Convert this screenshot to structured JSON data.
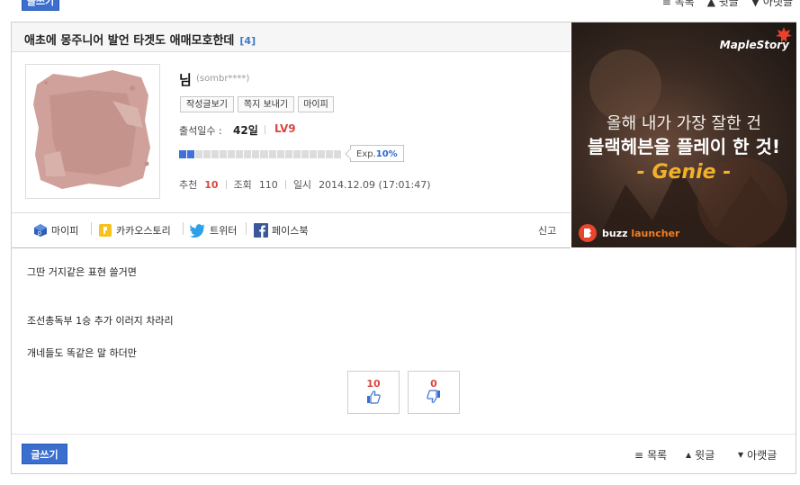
{
  "toolbar": {
    "write_label": "글쓰기",
    "list_label": "목록",
    "up_label": "윗글",
    "down_label": "아랫글"
  },
  "post": {
    "title": "애초에 몽주니어 발언 타겟도 애매모호한데",
    "comment_count": "[4]",
    "report_label": "신고",
    "content_lines": [
      "그딴 거지같은 표현 쓸거면",
      "조선총독부 1승 추가 이러지 차라리",
      "개네들도 똑같은 말 하더만"
    ]
  },
  "author": {
    "nickname": "님",
    "id_masked": "(sombr****)",
    "buttons": [
      "작성글보기",
      "쪽지 보내기",
      "마이피"
    ],
    "attendance_label": "출석일수 :",
    "attendance_value": "42일",
    "level": "LV9",
    "exp_label": "Exp.",
    "exp_percent": "10%",
    "exp_fraction": 0.1
  },
  "stats": {
    "recommend_label": "추천",
    "recommend_value": "10",
    "views_label": "조회",
    "views_value": "110",
    "date_label": "일시",
    "date_value": "2014.12.09 (17:01:47)"
  },
  "share": {
    "items": [
      "마이피",
      "카카오스토리",
      "트위터",
      "페이스북"
    ]
  },
  "votes": {
    "up": "10",
    "down": "0"
  },
  "ad": {
    "brand": "MapleStory",
    "line1": "올해 내가 가장 잘한 건",
    "line2": "블랙헤븐을 플레이 한 것!",
    "tagline": "- Genie -",
    "buzz": "buzz",
    "launcher": "launcher"
  },
  "colors": {
    "accent_blue": "#3a6fd0",
    "count_blue": "#3c78c8",
    "highlight_red": "#d9473f",
    "ad_orange": "#f2b12a"
  }
}
